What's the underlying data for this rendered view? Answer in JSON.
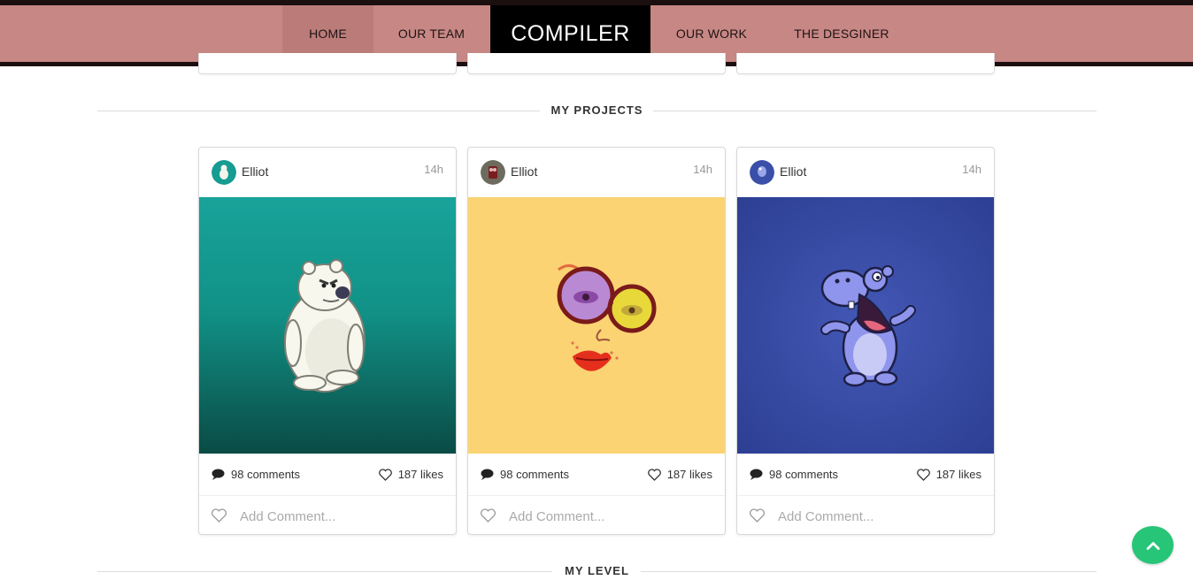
{
  "nav": {
    "items": [
      {
        "label": "HOME",
        "active": true
      },
      {
        "label": "OUR TEAM",
        "active": false
      },
      {
        "label": "OUR WORK",
        "active": false
      },
      {
        "label": "THE DESGINER",
        "active": false
      }
    ],
    "brand": "COMPILER",
    "colors": {
      "bar": "#c78784",
      "active": "#bb7c79",
      "brand_bg": "#000000",
      "edge": "#1c0f10"
    }
  },
  "sections": {
    "projects_title": "MY PROJECTS",
    "level_title": "MY LEVEL"
  },
  "cards": [
    {
      "author": "Elliot",
      "time": "14h",
      "avatar_icon": "polar-bear-avatar",
      "image": "polar-bear-illustration",
      "image_bg": "#159e94",
      "comments": "98 comments",
      "likes": "187 likes",
      "add_comment_placeholder": "Add Comment..."
    },
    {
      "author": "Elliot",
      "time": "14h",
      "avatar_icon": "face-glasses-avatar",
      "image": "face-with-glasses-illustration",
      "image_bg": "#fbd373",
      "comments": "98 comments",
      "likes": "187 likes",
      "add_comment_placeholder": "Add Comment..."
    },
    {
      "author": "Elliot",
      "time": "14h",
      "avatar_icon": "hippo-avatar",
      "image": "hippo-illustration",
      "image_bg": "#3a4fa8",
      "comments": "98 comments",
      "likes": "187 likes",
      "add_comment_placeholder": "Add Comment..."
    }
  ],
  "back_to_top": {
    "icon": "chevron-up-icon",
    "color": "#27c577"
  }
}
